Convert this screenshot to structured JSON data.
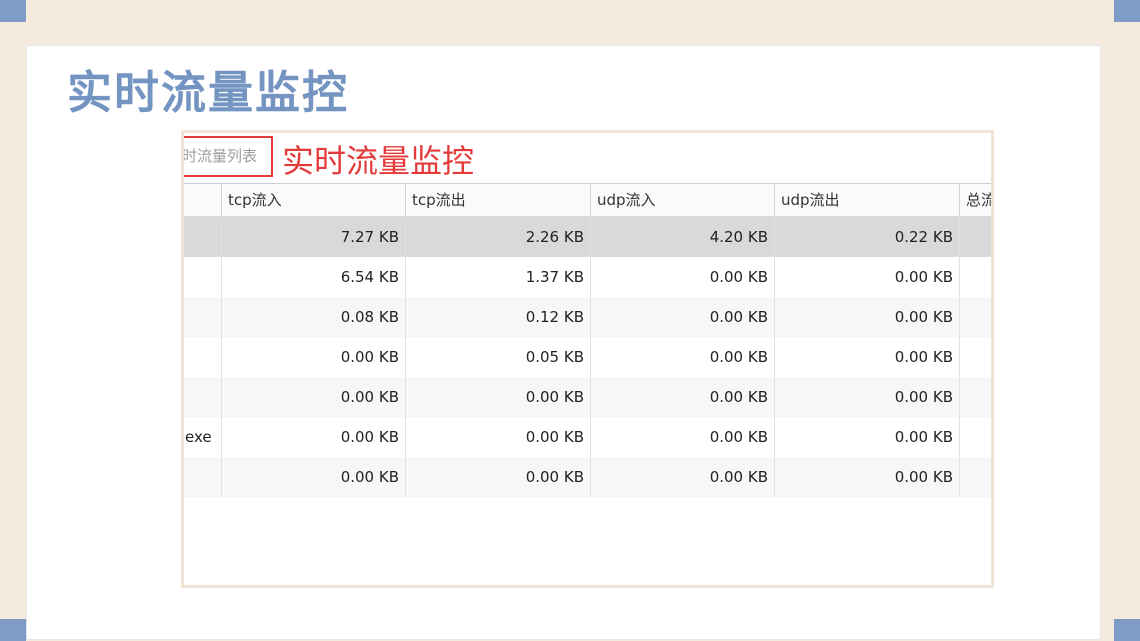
{
  "slide": {
    "title": "实时流量监控"
  },
  "screenshot": {
    "tab_label": "时流量列表",
    "annotation": "实时流量监控",
    "columns": [
      "",
      "tcp流入",
      "tcp流出",
      "udp流入",
      "udp流出",
      "总流"
    ],
    "rows": [
      {
        "name": "",
        "tcp_in": "7.27 KB",
        "tcp_out": "2.26 KB",
        "udp_in": "4.20 KB",
        "udp_out": "0.22 KB",
        "selected": true
      },
      {
        "name": "",
        "tcp_in": "6.54 KB",
        "tcp_out": "1.37 KB",
        "udp_in": "0.00 KB",
        "udp_out": "0.00 KB"
      },
      {
        "name": "",
        "tcp_in": "0.08 KB",
        "tcp_out": "0.12 KB",
        "udp_in": "0.00 KB",
        "udp_out": "0.00 KB"
      },
      {
        "name": "",
        "tcp_in": "0.00 KB",
        "tcp_out": "0.05 KB",
        "udp_in": "0.00 KB",
        "udp_out": "0.00 KB"
      },
      {
        "name": "",
        "tcp_in": "0.00 KB",
        "tcp_out": "0.00 KB",
        "udp_in": "0.00 KB",
        "udp_out": "0.00 KB"
      },
      {
        "name": "exe",
        "tcp_in": "0.00 KB",
        "tcp_out": "0.00 KB",
        "udp_in": "0.00 KB",
        "udp_out": "0.00 KB"
      },
      {
        "name": "",
        "tcp_in": "0.00 KB",
        "tcp_out": "0.00 KB",
        "udp_in": "0.00 KB",
        "udp_out": "0.00 KB"
      }
    ]
  },
  "colors": {
    "title": "#7494c2",
    "corner": "#7e9cc6",
    "annotation": "#e53a3a",
    "background": "#f3e9dd"
  }
}
